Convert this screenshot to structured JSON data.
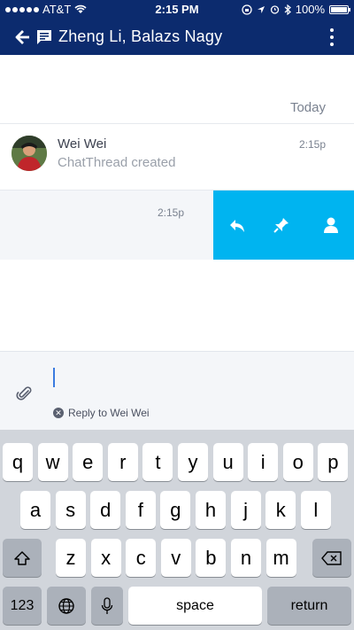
{
  "status_bar": {
    "carrier": "AT&T",
    "time": "2:15 PM",
    "battery": "100%",
    "battery_level": 1.0
  },
  "header": {
    "title": "Zheng Li, Balazs Nagy"
  },
  "thread": {
    "date_separator": "Today",
    "messages": [
      {
        "sender": "Wei Wei",
        "body": "ChatThread created",
        "time": "2:15p"
      },
      {
        "time": "2:15p"
      }
    ]
  },
  "composer": {
    "reply_to": "Reply to Wei Wei"
  },
  "keyboard": {
    "row1": [
      "q",
      "w",
      "e",
      "r",
      "t",
      "y",
      "u",
      "i",
      "o",
      "p"
    ],
    "row2": [
      "a",
      "s",
      "d",
      "f",
      "g",
      "h",
      "j",
      "k",
      "l"
    ],
    "row3": [
      "z",
      "x",
      "c",
      "v",
      "b",
      "n",
      "m"
    ],
    "numbers_label": "123",
    "space_label": "space",
    "return_label": "return"
  },
  "colors": {
    "header_bg": "#0c2b6e",
    "action_bar_bg": "#00b4f0",
    "accent_caret": "#3a7be0"
  }
}
